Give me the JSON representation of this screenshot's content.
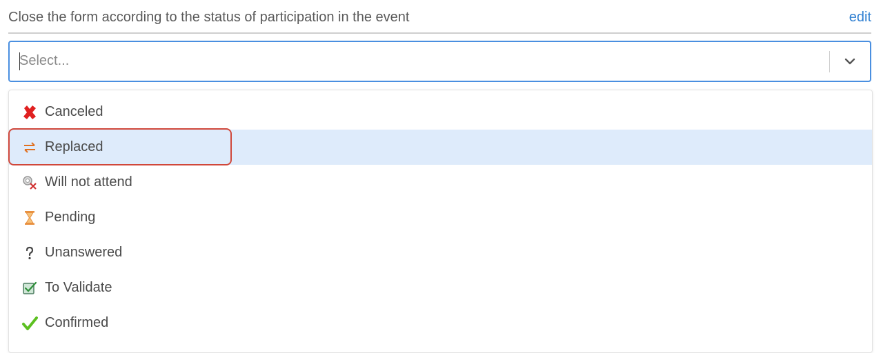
{
  "form": {
    "label": "Close the form according to the status of participation in the event",
    "edit_label": "edit"
  },
  "select": {
    "placeholder": "Select..."
  },
  "options": [
    {
      "label": "Canceled",
      "icon": "canceled-x-icon",
      "selected": false
    },
    {
      "label": "Replaced",
      "icon": "replaced-arrows-icon",
      "selected": true
    },
    {
      "label": "Will not attend",
      "icon": "will-not-attend-icon",
      "selected": false
    },
    {
      "label": "Pending",
      "icon": "hourglass-icon",
      "selected": false
    },
    {
      "label": "Unanswered",
      "icon": "question-mark-icon",
      "selected": false
    },
    {
      "label": "To Validate",
      "icon": "to-validate-icon",
      "selected": false
    },
    {
      "label": "Confirmed",
      "icon": "checkmark-icon",
      "selected": false
    }
  ],
  "colors": {
    "accent": "#4a8fe0",
    "link": "#2f7fd1",
    "selected_row": "#deebfb",
    "annotation": "#d0473a"
  }
}
